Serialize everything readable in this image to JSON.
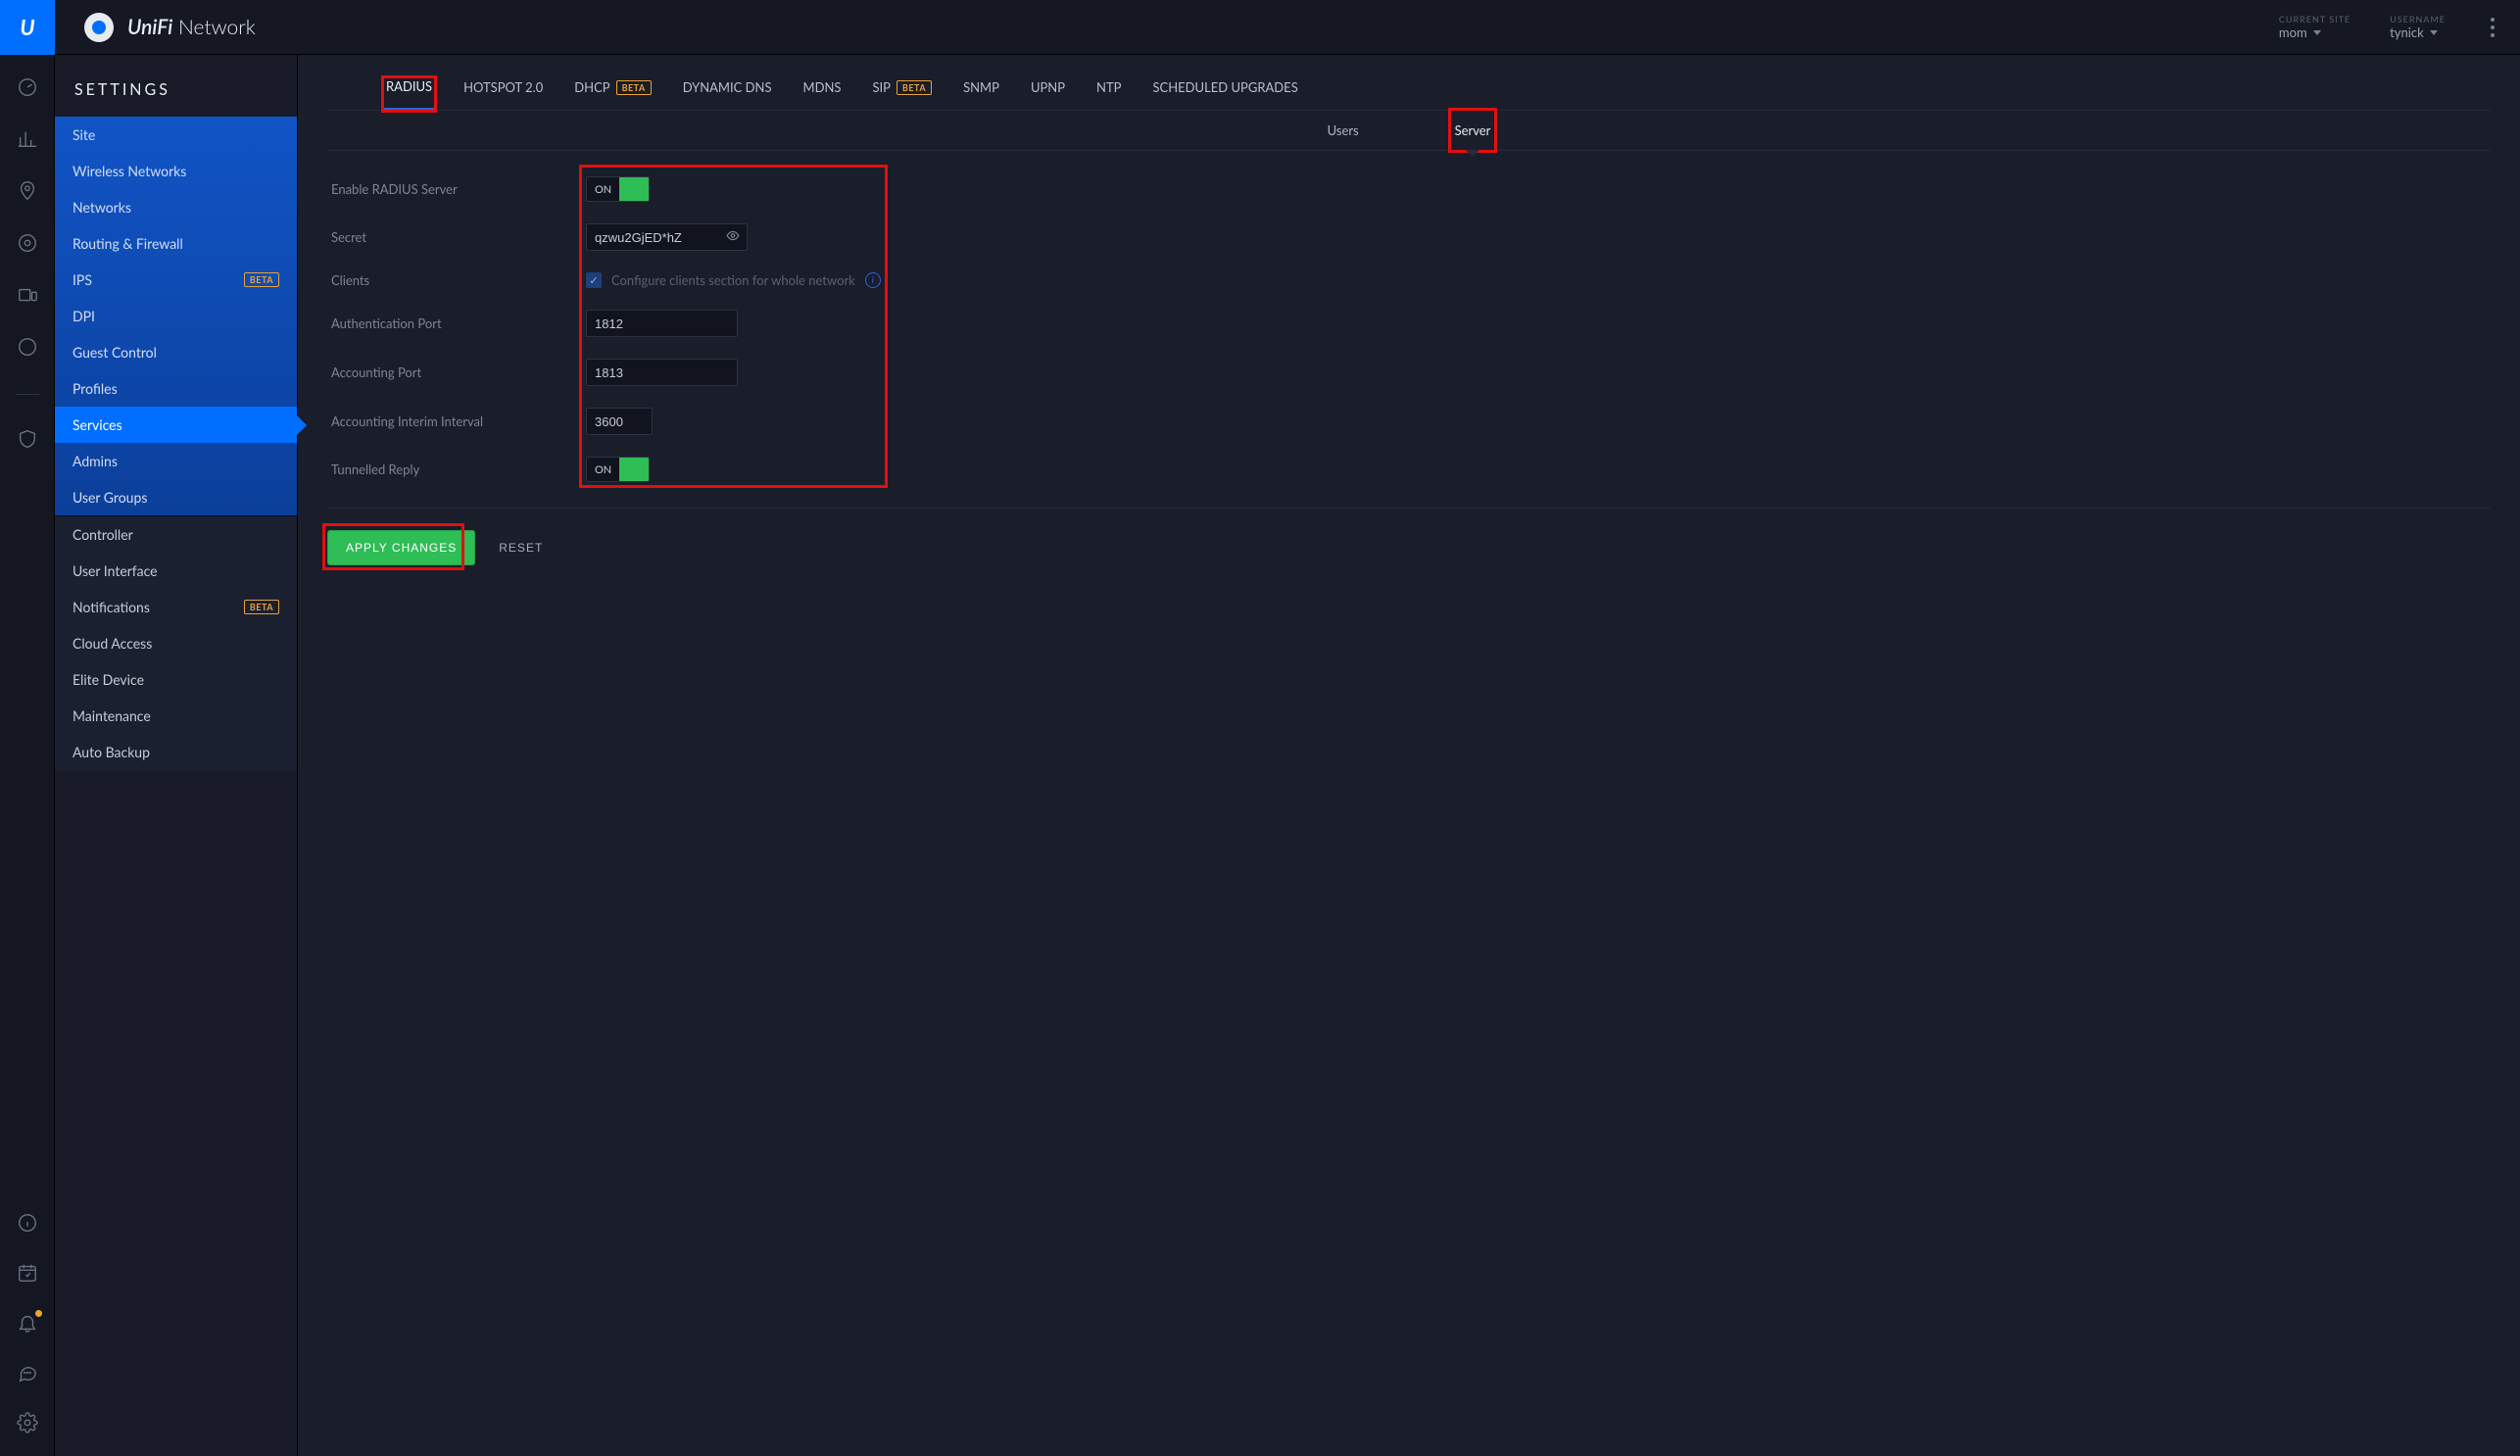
{
  "brand": {
    "name_html": "UniFi",
    "suffix": "Network"
  },
  "header": {
    "site_label": "CURRENT SITE",
    "site_value": "mom",
    "user_label": "USERNAME",
    "user_value": "tynick"
  },
  "sidebar_title": "SETTINGS",
  "sidebar": {
    "group1": [
      {
        "label": "Site"
      },
      {
        "label": "Wireless Networks"
      },
      {
        "label": "Networks"
      },
      {
        "label": "Routing & Firewall"
      },
      {
        "label": "IPS",
        "beta": true
      },
      {
        "label": "DPI"
      },
      {
        "label": "Guest Control"
      },
      {
        "label": "Profiles"
      },
      {
        "label": "Services",
        "active": true
      },
      {
        "label": "Admins"
      },
      {
        "label": "User Groups"
      }
    ],
    "group2": [
      {
        "label": "Controller"
      },
      {
        "label": "User Interface"
      },
      {
        "label": "Notifications",
        "beta": true
      },
      {
        "label": "Cloud Access"
      },
      {
        "label": "Elite Device"
      },
      {
        "label": "Maintenance"
      },
      {
        "label": "Auto Backup"
      }
    ]
  },
  "tabs_primary": [
    {
      "label": "RADIUS",
      "active": true
    },
    {
      "label": "HOTSPOT 2.0"
    },
    {
      "label": "DHCP",
      "beta": true
    },
    {
      "label": "DYNAMIC DNS"
    },
    {
      "label": "MDNS"
    },
    {
      "label": "SIP",
      "beta": true
    },
    {
      "label": "SNMP"
    },
    {
      "label": "UPNP"
    },
    {
      "label": "NTP"
    },
    {
      "label": "SCHEDULED UPGRADES"
    }
  ],
  "tabs_secondary": [
    {
      "label": "Users"
    },
    {
      "label": "Server",
      "active": true
    }
  ],
  "form": {
    "enable_label": "Enable RADIUS Server",
    "enable_value": "ON",
    "secret_label": "Secret",
    "secret_value": "qzwu2GjED*hZ",
    "clients_label": "Clients",
    "clients_checkbox_text": "Configure clients section for whole network",
    "auth_port_label": "Authentication Port",
    "auth_port_value": "1812",
    "acct_port_label": "Accounting Port",
    "acct_port_value": "1813",
    "interval_label": "Accounting Interim Interval",
    "interval_value": "3600",
    "tunnel_label": "Tunnelled Reply",
    "tunnel_value": "ON"
  },
  "actions": {
    "apply": "APPLY CHANGES",
    "reset": "RESET"
  },
  "beta_text": "BETA"
}
